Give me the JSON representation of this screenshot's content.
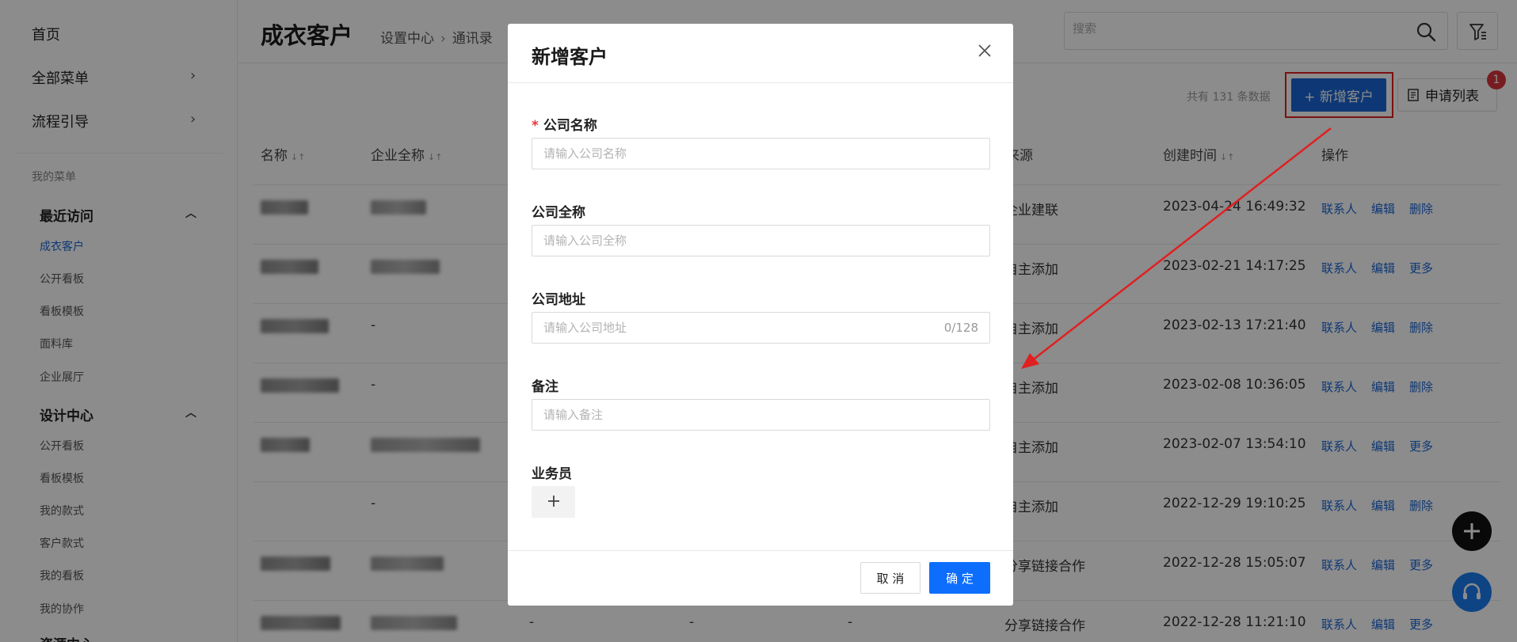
{
  "sidebar": {
    "home": "首页",
    "all_menu": "全部菜单",
    "flow_guide": "流程引导",
    "my_menu": "我的菜单",
    "groups": [
      {
        "title": "最近访问",
        "items": [
          "成衣客户",
          "公开看板",
          "看板模板",
          "面料库",
          "企业展厅"
        ]
      },
      {
        "title": "设计中心",
        "items": [
          "公开看板",
          "看板模板",
          "我的款式",
          "客户款式",
          "我的看板",
          "我的协作"
        ]
      }
    ],
    "next_group_partial": "资源中心"
  },
  "header": {
    "title": "成衣客户",
    "breadcrumb": [
      "设置中心",
      "通讯录"
    ],
    "search_placeholder": "搜索"
  },
  "toolbar": {
    "total_text": "共有 131 条数据",
    "add_label": "+ 新增客户",
    "apply_label": "申请列表",
    "badge": "1"
  },
  "table": {
    "columns": [
      "名称",
      "企业全称",
      "来源",
      "创建时间",
      "操作"
    ],
    "rows": [
      {
        "name_blur": true,
        "full_blur": true,
        "source": "企业建联",
        "created": "2023-04-24 16:49:32",
        "actions": [
          "联系人",
          "编辑",
          "删除"
        ]
      },
      {
        "name_blur": true,
        "full_blur": true,
        "source": "自主添加",
        "created": "2023-02-21 14:17:25",
        "actions": [
          "联系人",
          "编辑",
          "更多"
        ]
      },
      {
        "name_blur": true,
        "full": "-",
        "source": "自主添加",
        "created": "2023-02-13 17:21:40",
        "actions": [
          "联系人",
          "编辑",
          "删除"
        ]
      },
      {
        "name_blur": true,
        "full": "-",
        "source": "自主添加",
        "created": "2023-02-08 10:36:05",
        "actions": [
          "联系人",
          "编辑",
          "删除"
        ]
      },
      {
        "name_blur": true,
        "full_blur": true,
        "source": "自主添加",
        "created": "2023-02-07 13:54:10",
        "actions": [
          "联系人",
          "编辑",
          "更多"
        ]
      },
      {
        "name_blur": false,
        "full": "-",
        "source": "自主添加",
        "created": "2022-12-29 19:10:25",
        "actions": [
          "联系人",
          "编辑",
          "删除"
        ]
      },
      {
        "name_blur": true,
        "full_blur": true,
        "source": "分享链接合作",
        "created": "2022-12-28 15:05:07",
        "actions": [
          "联系人",
          "编辑",
          "更多"
        ]
      },
      {
        "name_blur": true,
        "full_blur": true,
        "extra": [
          "-",
          "-",
          "-"
        ],
        "source": "分享链接合作",
        "created": "2022-12-28 11:21:10",
        "actions": [
          "联系人",
          "编辑",
          "更多"
        ]
      }
    ]
  },
  "dialog": {
    "title": "新增客户",
    "fields": [
      {
        "label": "公司名称",
        "required": true,
        "placeholder": "请输入公司名称"
      },
      {
        "label": "公司全称",
        "required": false,
        "placeholder": "请输入公司全称"
      },
      {
        "label": "公司地址",
        "required": false,
        "placeholder": "请输入公司地址",
        "counter": "0/128"
      },
      {
        "label": "备注",
        "required": false,
        "placeholder": "请输入备注"
      }
    ],
    "salesman_label": "业务员",
    "cancel_label": "取 消",
    "ok_label": "确 定"
  },
  "colors": {
    "primary": "#1a66d6",
    "highlight": "#e02020",
    "ok_button": "#0d6efd"
  }
}
